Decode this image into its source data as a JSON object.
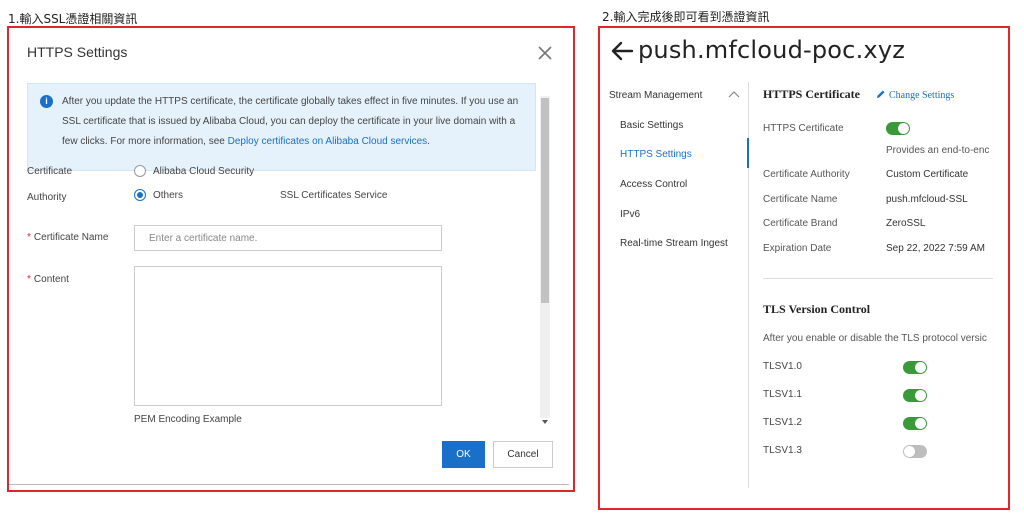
{
  "step1_label": "1.輸入SSL憑證相關資訊",
  "step2_label": "2.輸入完成後即可看到憑證資訊",
  "dialog": {
    "title": "HTTPS Settings",
    "info_text": "After you update the HTTPS certificate, the certificate globally takes effect in five minutes. If you use an SSL certificate that is issued by Alibaba Cloud, you can deploy the certificate in your live domain with a few clicks. For more information, see ",
    "info_link": "Deploy certificates on Alibaba Cloud services",
    "info_tail": ".",
    "cert_authority_label_1": "Certificate",
    "cert_authority_label_2": "Authority",
    "option_alibaba": "Alibaba Cloud Security",
    "option_others": "Others",
    "ssl_service_link": "SSL Certificates Service",
    "cert_name_label": "Certificate Name",
    "cert_name_placeholder": "Enter a certificate name.",
    "content_label": "Content",
    "pem_example_link": "PEM Encoding Example",
    "ok_label": "OK",
    "cancel_label": "Cancel",
    "required_mark": "*"
  },
  "detail": {
    "domain": "push.mfcloud-poc.xyz",
    "nav_group": "Stream Management",
    "nav_items": [
      "Basic Settings",
      "HTTPS Settings",
      "Access Control",
      "IPv6",
      "Real-time Stream Ingest"
    ],
    "active_nav": "HTTPS Settings",
    "https_section_title": "HTTPS Certificate",
    "change_settings": "Change Settings",
    "https_cert_label": "HTTPS Certificate",
    "https_cert_enabled": true,
    "https_desc": "Provides an end-to-enc",
    "fields": [
      {
        "label": "Certificate Authority",
        "value": "Custom Certificate"
      },
      {
        "label": "Certificate Name",
        "value": "push.mfcloud-SSL"
      },
      {
        "label": "Certificate Brand",
        "value": "ZeroSSL"
      },
      {
        "label": "Expiration Date",
        "value": "Sep 22, 2022 7:59 AM"
      }
    ],
    "tls_section_title": "TLS Version Control",
    "tls_desc": "After you enable or disable the TLS protocol versic",
    "tls_versions": [
      {
        "label": "TLSV1.0",
        "enabled": true
      },
      {
        "label": "TLSV1.1",
        "enabled": true
      },
      {
        "label": "TLSV1.2",
        "enabled": true
      },
      {
        "label": "TLSV1.3",
        "enabled": false
      }
    ]
  },
  "colors": {
    "accent": "#1a6fc9",
    "highlight_border": "#e0262a",
    "toggle_on": "#3a9a3a",
    "toggle_off": "#bdbdbd"
  }
}
